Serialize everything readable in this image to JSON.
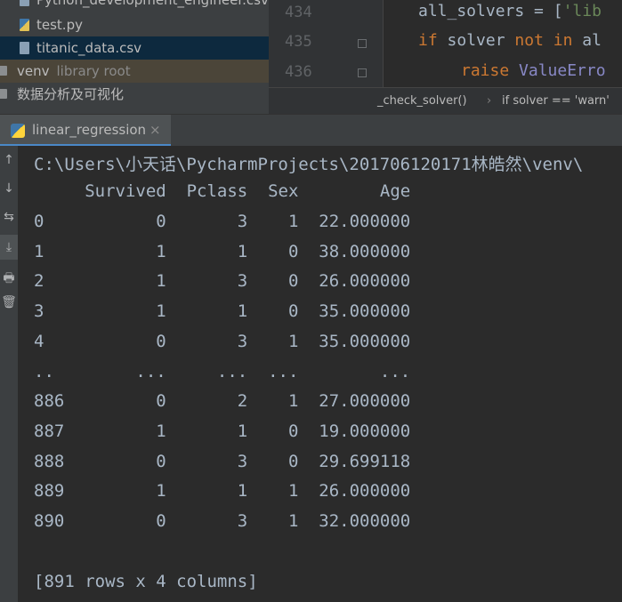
{
  "project_tree": {
    "items": [
      {
        "name": "Python_development_engineer.csv",
        "kind": "csv"
      },
      {
        "name": "test.py",
        "kind": "py"
      },
      {
        "name": "titanic_data.csv",
        "kind": "csv",
        "selected": true
      },
      {
        "name": "venv",
        "suffix": "library root",
        "kind": "folder"
      },
      {
        "name": "数据分析及可视化",
        "kind": "folder"
      }
    ]
  },
  "editor": {
    "lines": [
      {
        "num": "434",
        "indent": "    ",
        "tokens": [
          {
            "t": "all_solvers = [",
            "c": ""
          },
          {
            "t": "'lib",
            "c": "str"
          }
        ]
      },
      {
        "num": "435",
        "indent": "    ",
        "tokens": [
          {
            "t": "if",
            "c": "kw"
          },
          {
            "t": " solver ",
            "c": ""
          },
          {
            "t": "not in",
            "c": "kw"
          },
          {
            "t": " al",
            "c": ""
          }
        ]
      },
      {
        "num": "436",
        "indent": "        ",
        "tokens": [
          {
            "t": "raise",
            "c": "kw"
          },
          {
            "t": " ",
            "c": ""
          },
          {
            "t": "ValueErro",
            "c": "cls"
          }
        ]
      }
    ],
    "breadcrumb": [
      "_check_solver()",
      "if solver == 'warn'"
    ],
    "breadcrumb_sep": "›"
  },
  "run_tab": {
    "label": "linear_regression",
    "close": "×"
  },
  "toolbar": {
    "icons": [
      "↑",
      "↓",
      "⇆",
      "⤓",
      "🖶",
      "🗑"
    ]
  },
  "console": {
    "path": "C:\\Users\\小天话\\PycharmProjects\\201706120171林皓然\\venv\\",
    "header": "     Survived  Pclass  Sex        Age",
    "rows": [
      "0           0       3    1  22.000000",
      "1           1       1    0  38.000000",
      "2           1       3    0  26.000000",
      "3           1       1    0  35.000000",
      "4           0       3    1  35.000000",
      "..        ...     ...  ...        ...",
      "886         0       2    1  27.000000",
      "887         1       1    0  19.000000",
      "888         0       3    0  29.699118",
      "889         1       1    1  26.000000",
      "890         0       3    1  32.000000"
    ],
    "summary": "[891 rows x 4 columns]"
  }
}
